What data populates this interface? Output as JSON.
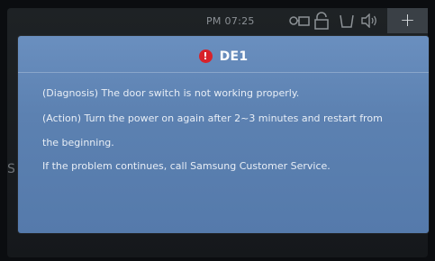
{
  "status_bar": {
    "time": "PM 07:25",
    "icons": [
      "door-lock-icon",
      "child-lock-icon",
      "tub-icon",
      "sound-icon"
    ],
    "plus_label": "+"
  },
  "background_hint": "S",
  "dialog": {
    "icon": "exclamation-icon",
    "icon_glyph": "!",
    "accent_color": "#d8222a",
    "title": "DE1",
    "lines": [
      "(Diagnosis) The door switch is not working properly.",
      "(Action) Turn the power on again after 2~3 minutes and restart from",
      "the beginning.",
      "If the problem continues, call Samsung Customer Service."
    ]
  }
}
